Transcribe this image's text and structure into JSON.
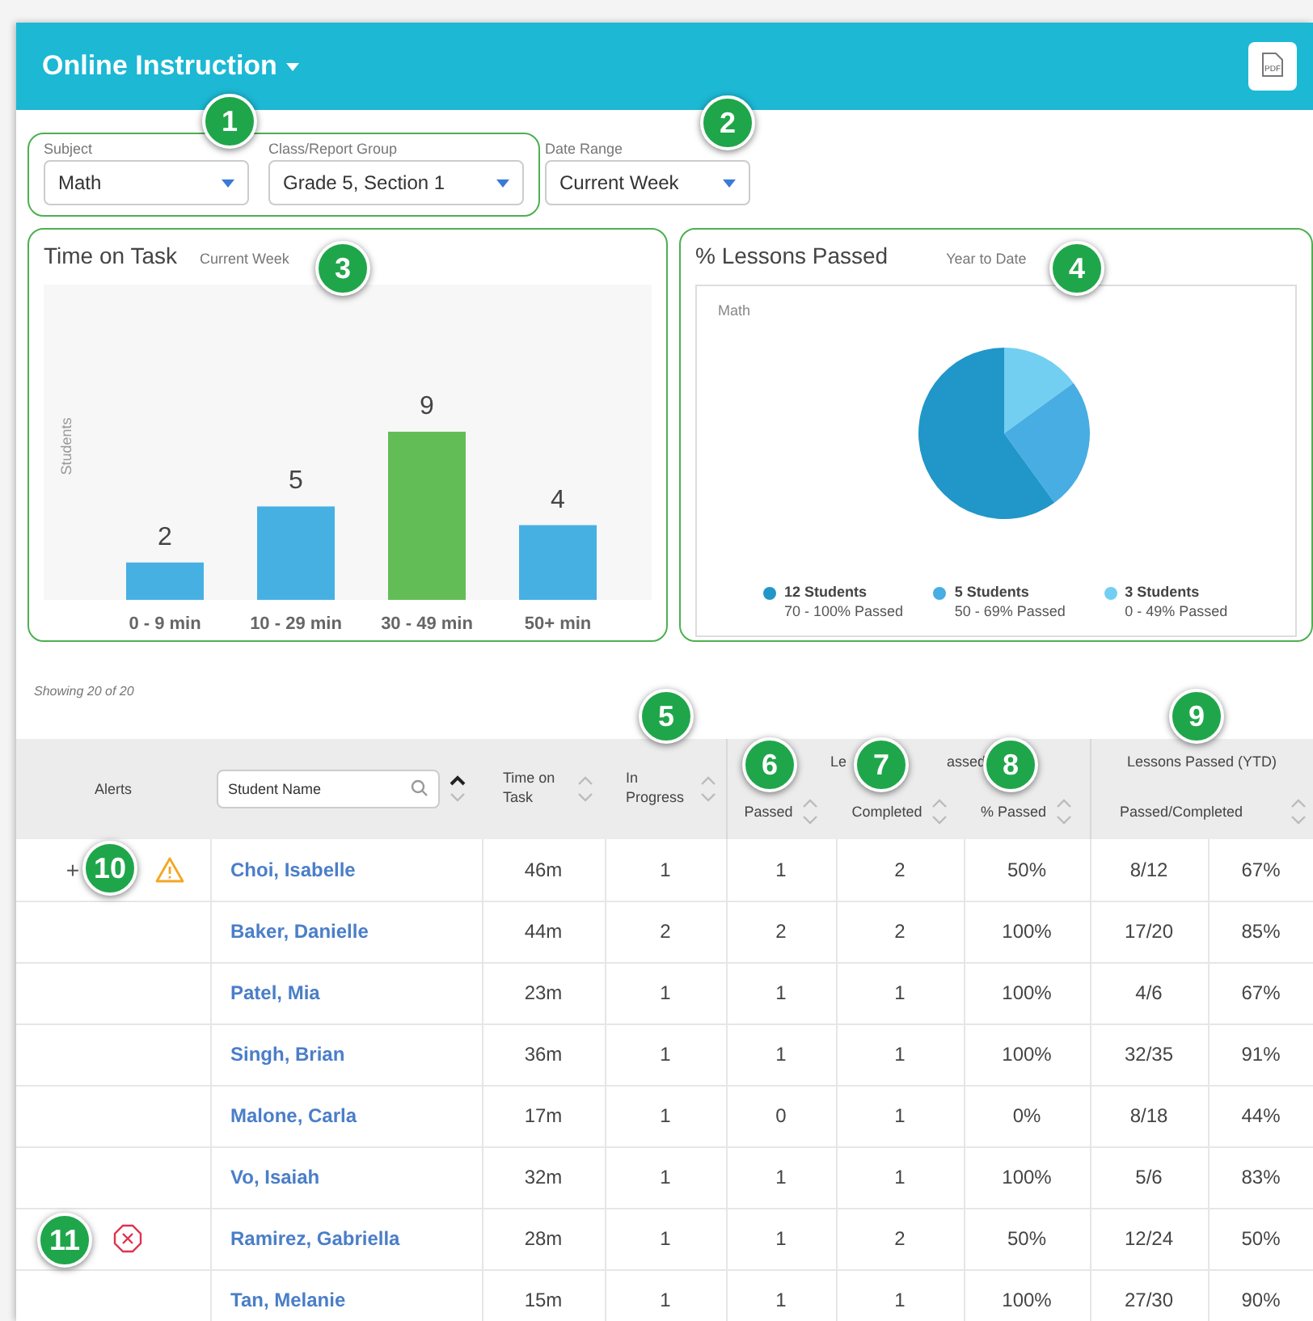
{
  "header": {
    "title": "Online Instruction",
    "pdf_label": "PDF"
  },
  "filters": [
    {
      "label": "Subject",
      "value": "Math"
    },
    {
      "label": "Class/Report Group",
      "value": "Grade 5, Section 1"
    },
    {
      "label": "Date Range",
      "value": "Current Week"
    }
  ],
  "time_on_task": {
    "title": "Time on Task",
    "subtitle": "Current Week",
    "chart_data": {
      "type": "bar",
      "ylabel": "Students",
      "categories": [
        "0 - 9 min",
        "10 - 29 min",
        "30 - 49 min",
        "50+ min"
      ],
      "stacked": true,
      "data_labels": true,
      "series": [
        {
          "color": "#47b0e3",
          "values": [
            2,
            5,
            null,
            4
          ]
        },
        {
          "color": "#63bd57",
          "values": [
            null,
            null,
            9,
            null
          ]
        }
      ]
    }
  },
  "lessons_passed": {
    "title": "% Lessons Passed",
    "subtitle": "Year to Date",
    "chart_data": {
      "type": "pie",
      "title": "Math",
      "legend": "bottom",
      "categories": [
        "70 - 100% Passed",
        "50 - 69% Passed",
        "0 - 49% Passed"
      ],
      "values": [
        60,
        25,
        15
      ]
    },
    "legend": [
      {
        "count": "12 Students",
        "color": "#2196c9"
      },
      {
        "count": "5 Students",
        "color": "#47ade2"
      },
      {
        "count": "3 Students",
        "color": "#72cff1"
      }
    ]
  },
  "table": {
    "showing": "Showing 20 of 20",
    "columns": [
      {
        "kind": "label",
        "label": "Alerts"
      },
      {
        "kind": "search",
        "placeholder": "Student Name",
        "sorted": true
      },
      {
        "kind": "label",
        "label": "Time on Task",
        "sorted": false
      },
      {
        "kind": "label",
        "label": "In Progress",
        "sorted": false
      }
    ],
    "groups": [
      {
        "label_parts": [
          "Le",
          "assed"
        ],
        "sub_columns": [
          {
            "label": "Passed",
            "sorted": false
          },
          {
            "label": "Completed",
            "sorted": false
          },
          {
            "label": "% Passed",
            "sorted": false
          }
        ]
      },
      {
        "label": "Lessons Passed (YTD)",
        "sub_columns": [
          {
            "label": "Passed/Completed",
            "sorted": false
          }
        ]
      }
    ],
    "rows": [
      {
        "warning": true,
        "error": false,
        "cells": [
          "+",
          "Choi, Isabelle",
          "46m",
          "1",
          "1",
          "2",
          "50%",
          "8/12",
          "67%"
        ]
      },
      {
        "warning": false,
        "error": false,
        "cells": [
          "",
          "Baker, Danielle",
          "44m",
          "2",
          "2",
          "2",
          "100%",
          "17/20",
          "85%"
        ]
      },
      {
        "warning": false,
        "error": false,
        "cells": [
          "",
          "Patel, Mia",
          "23m",
          "1",
          "1",
          "1",
          "100%",
          "4/6",
          "67%"
        ]
      },
      {
        "warning": false,
        "error": false,
        "cells": [
          "",
          "Singh, Brian",
          "36m",
          "1",
          "1",
          "1",
          "100%",
          "32/35",
          "91%"
        ]
      },
      {
        "warning": false,
        "error": false,
        "cells": [
          "",
          "Malone, Carla",
          "17m",
          "1",
          "0",
          "1",
          "0%",
          "8/18",
          "44%"
        ]
      },
      {
        "warning": false,
        "error": false,
        "cells": [
          "",
          "Vo, Isaiah",
          "32m",
          "1",
          "1",
          "1",
          "100%",
          "5/6",
          "83%"
        ]
      },
      {
        "warning": false,
        "error": true,
        "cells": [
          "",
          "Ramirez, Gabriella",
          "28m",
          "1",
          "1",
          "2",
          "50%",
          "12/24",
          "50%"
        ]
      },
      {
        "warning": false,
        "error": false,
        "cells": [
          "",
          "Tan, Melanie",
          "15m",
          "1",
          "1",
          "1",
          "100%",
          "27/30",
          "90%"
        ]
      }
    ]
  },
  "callouts": [
    "1",
    "2",
    "3",
    "4",
    "5",
    "6",
    "7",
    "8",
    "9",
    "10",
    "11"
  ]
}
